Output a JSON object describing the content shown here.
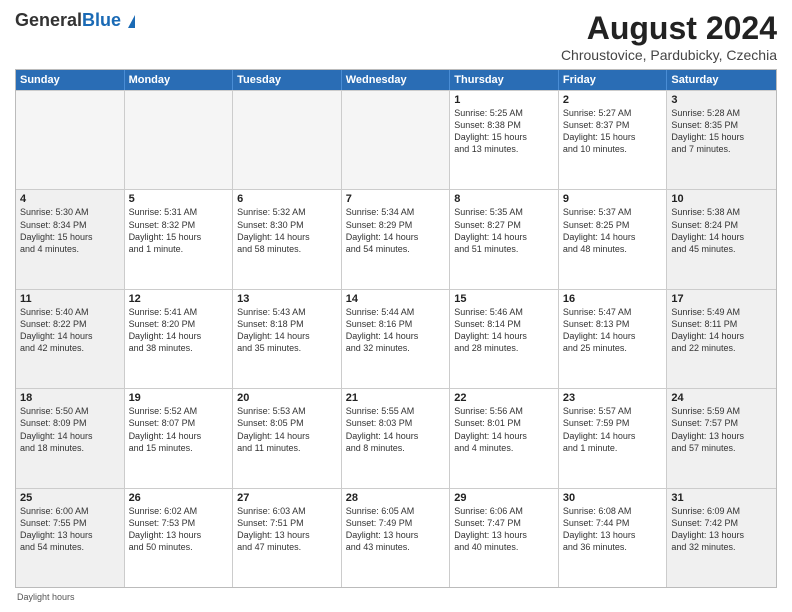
{
  "header": {
    "logo_general": "General",
    "logo_blue": "Blue",
    "title": "August 2024",
    "location": "Chroustovice, Pardubicky, Czechia"
  },
  "days_of_week": [
    "Sunday",
    "Monday",
    "Tuesday",
    "Wednesday",
    "Thursday",
    "Friday",
    "Saturday"
  ],
  "footer": "Daylight hours",
  "weeks": [
    [
      {
        "day": "",
        "info": "",
        "empty": true
      },
      {
        "day": "",
        "info": "",
        "empty": true
      },
      {
        "day": "",
        "info": "",
        "empty": true
      },
      {
        "day": "",
        "info": "",
        "empty": true
      },
      {
        "day": "1",
        "info": "Sunrise: 5:25 AM\nSunset: 8:38 PM\nDaylight: 15 hours\nand 13 minutes.",
        "empty": false
      },
      {
        "day": "2",
        "info": "Sunrise: 5:27 AM\nSunset: 8:37 PM\nDaylight: 15 hours\nand 10 minutes.",
        "empty": false
      },
      {
        "day": "3",
        "info": "Sunrise: 5:28 AM\nSunset: 8:35 PM\nDaylight: 15 hours\nand 7 minutes.",
        "empty": false
      }
    ],
    [
      {
        "day": "4",
        "info": "Sunrise: 5:30 AM\nSunset: 8:34 PM\nDaylight: 15 hours\nand 4 minutes.",
        "empty": false
      },
      {
        "day": "5",
        "info": "Sunrise: 5:31 AM\nSunset: 8:32 PM\nDaylight: 15 hours\nand 1 minute.",
        "empty": false
      },
      {
        "day": "6",
        "info": "Sunrise: 5:32 AM\nSunset: 8:30 PM\nDaylight: 14 hours\nand 58 minutes.",
        "empty": false
      },
      {
        "day": "7",
        "info": "Sunrise: 5:34 AM\nSunset: 8:29 PM\nDaylight: 14 hours\nand 54 minutes.",
        "empty": false
      },
      {
        "day": "8",
        "info": "Sunrise: 5:35 AM\nSunset: 8:27 PM\nDaylight: 14 hours\nand 51 minutes.",
        "empty": false
      },
      {
        "day": "9",
        "info": "Sunrise: 5:37 AM\nSunset: 8:25 PM\nDaylight: 14 hours\nand 48 minutes.",
        "empty": false
      },
      {
        "day": "10",
        "info": "Sunrise: 5:38 AM\nSunset: 8:24 PM\nDaylight: 14 hours\nand 45 minutes.",
        "empty": false
      }
    ],
    [
      {
        "day": "11",
        "info": "Sunrise: 5:40 AM\nSunset: 8:22 PM\nDaylight: 14 hours\nand 42 minutes.",
        "empty": false
      },
      {
        "day": "12",
        "info": "Sunrise: 5:41 AM\nSunset: 8:20 PM\nDaylight: 14 hours\nand 38 minutes.",
        "empty": false
      },
      {
        "day": "13",
        "info": "Sunrise: 5:43 AM\nSunset: 8:18 PM\nDaylight: 14 hours\nand 35 minutes.",
        "empty": false
      },
      {
        "day": "14",
        "info": "Sunrise: 5:44 AM\nSunset: 8:16 PM\nDaylight: 14 hours\nand 32 minutes.",
        "empty": false
      },
      {
        "day": "15",
        "info": "Sunrise: 5:46 AM\nSunset: 8:14 PM\nDaylight: 14 hours\nand 28 minutes.",
        "empty": false
      },
      {
        "day": "16",
        "info": "Sunrise: 5:47 AM\nSunset: 8:13 PM\nDaylight: 14 hours\nand 25 minutes.",
        "empty": false
      },
      {
        "day": "17",
        "info": "Sunrise: 5:49 AM\nSunset: 8:11 PM\nDaylight: 14 hours\nand 22 minutes.",
        "empty": false
      }
    ],
    [
      {
        "day": "18",
        "info": "Sunrise: 5:50 AM\nSunset: 8:09 PM\nDaylight: 14 hours\nand 18 minutes.",
        "empty": false
      },
      {
        "day": "19",
        "info": "Sunrise: 5:52 AM\nSunset: 8:07 PM\nDaylight: 14 hours\nand 15 minutes.",
        "empty": false
      },
      {
        "day": "20",
        "info": "Sunrise: 5:53 AM\nSunset: 8:05 PM\nDaylight: 14 hours\nand 11 minutes.",
        "empty": false
      },
      {
        "day": "21",
        "info": "Sunrise: 5:55 AM\nSunset: 8:03 PM\nDaylight: 14 hours\nand 8 minutes.",
        "empty": false
      },
      {
        "day": "22",
        "info": "Sunrise: 5:56 AM\nSunset: 8:01 PM\nDaylight: 14 hours\nand 4 minutes.",
        "empty": false
      },
      {
        "day": "23",
        "info": "Sunrise: 5:57 AM\nSunset: 7:59 PM\nDaylight: 14 hours\nand 1 minute.",
        "empty": false
      },
      {
        "day": "24",
        "info": "Sunrise: 5:59 AM\nSunset: 7:57 PM\nDaylight: 13 hours\nand 57 minutes.",
        "empty": false
      }
    ],
    [
      {
        "day": "25",
        "info": "Sunrise: 6:00 AM\nSunset: 7:55 PM\nDaylight: 13 hours\nand 54 minutes.",
        "empty": false
      },
      {
        "day": "26",
        "info": "Sunrise: 6:02 AM\nSunset: 7:53 PM\nDaylight: 13 hours\nand 50 minutes.",
        "empty": false
      },
      {
        "day": "27",
        "info": "Sunrise: 6:03 AM\nSunset: 7:51 PM\nDaylight: 13 hours\nand 47 minutes.",
        "empty": false
      },
      {
        "day": "28",
        "info": "Sunrise: 6:05 AM\nSunset: 7:49 PM\nDaylight: 13 hours\nand 43 minutes.",
        "empty": false
      },
      {
        "day": "29",
        "info": "Sunrise: 6:06 AM\nSunset: 7:47 PM\nDaylight: 13 hours\nand 40 minutes.",
        "empty": false
      },
      {
        "day": "30",
        "info": "Sunrise: 6:08 AM\nSunset: 7:44 PM\nDaylight: 13 hours\nand 36 minutes.",
        "empty": false
      },
      {
        "day": "31",
        "info": "Sunrise: 6:09 AM\nSunset: 7:42 PM\nDaylight: 13 hours\nand 32 minutes.",
        "empty": false
      }
    ]
  ]
}
